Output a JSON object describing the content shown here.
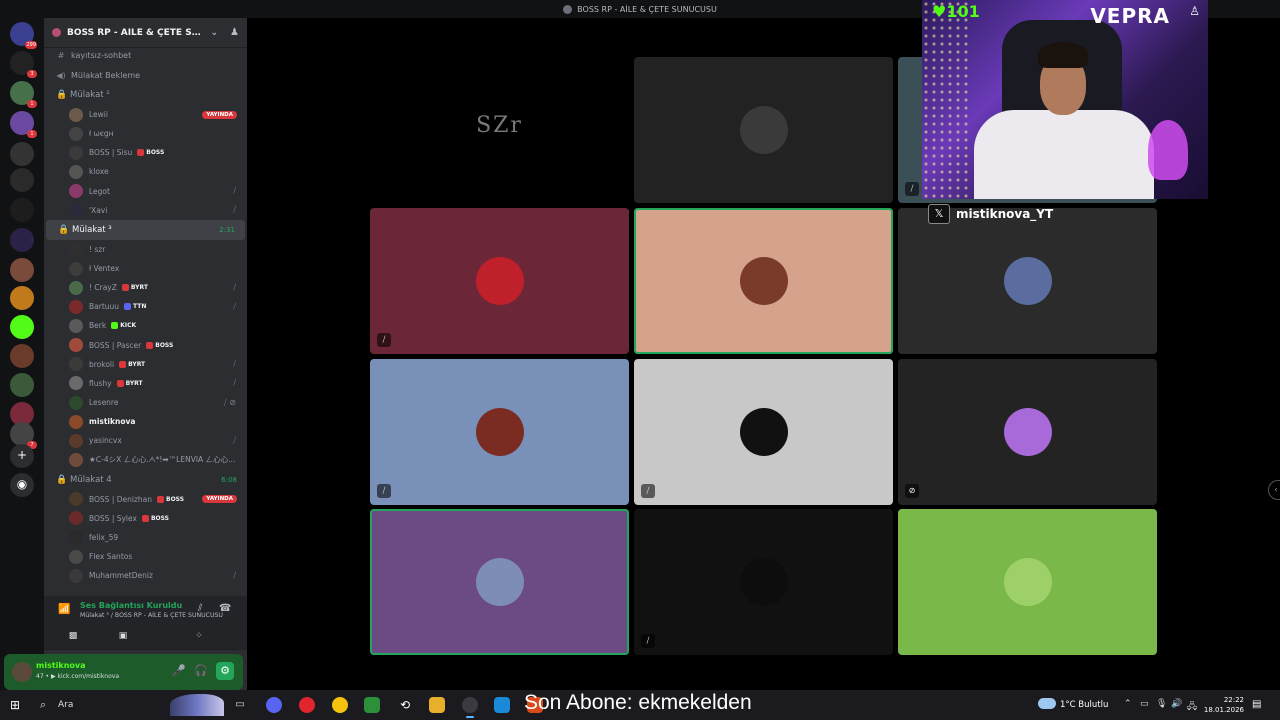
{
  "window": {
    "title": "BOSS RP - AİLE & ÇETE SUNUCUSU"
  },
  "server": {
    "name": "BOSS RP - AİLE & ÇETE SUNUCUSU"
  },
  "server_rail": {
    "badges": [
      "299",
      "3",
      "1",
      "1",
      "7"
    ]
  },
  "channels": [
    {
      "name": "kayıtsız-sohbet",
      "icon": "hash-icon"
    },
    {
      "name": "Mülakat Bekleme",
      "icon": "speaker-icon"
    }
  ],
  "voice_channels": [
    {
      "name": "Mülakat ²",
      "time": "",
      "users": [
        {
          "name": "Lewii",
          "live": "YAYINDA"
        },
        {
          "name": "ł ωєgн"
        },
        {
          "name": "BOSS | Sisu",
          "tag": "BOSS"
        },
        {
          "name": "kloxe"
        },
        {
          "name": "Legot",
          "mute": "⧸"
        },
        {
          "name": "'Xavi",
          "mute": "⧸"
        }
      ]
    },
    {
      "name": "Mülakat ³",
      "time": "2:31",
      "users": [
        {
          "name": "! szr"
        },
        {
          "name": "ł Ventex"
        },
        {
          "name": "! CrayZ",
          "tag": "BYRT",
          "mute": "⧸"
        },
        {
          "name": "Bartuuu",
          "tag": "TTN",
          "mute": "⧸"
        },
        {
          "name": "Berk",
          "tag": "KICK"
        },
        {
          "name": "BOSS | Pascer",
          "tag": "BOSS"
        },
        {
          "name": "brokoli",
          "tag": "BYRT",
          "mute": "⧸"
        },
        {
          "name": "flushy",
          "tag": "BYRT",
          "mute": "⧸"
        },
        {
          "name": "Lesenre",
          "mute": "⧸ ⊘"
        },
        {
          "name": "mistiknova",
          "bright": true
        },
        {
          "name": "yasincvx",
          "mute": "⧸"
        },
        {
          "name": "★ᑕ-4シX ㄥ心心.ᗅ*!➡™LENVIA ㄥ心心..."
        }
      ]
    },
    {
      "name": "Mülakat 4",
      "time": "6:08",
      "users": [
        {
          "name": "BOSS | Denizhan",
          "tag": "BOSS",
          "live": "YAYINDA"
        },
        {
          "name": "BOSS | Sylex",
          "tag": "BOSS"
        },
        {
          "name": "felix_59"
        },
        {
          "name": "Flex Santos"
        },
        {
          "name": "MuhammetDeniz",
          "mute": "⧸"
        }
      ]
    }
  ],
  "voice_status": {
    "title": "Ses Bağlantısı Kuruldu",
    "subtitle": "Mülakat ³ / BOSS RP - AİLE & ÇETE SUNUCUSU"
  },
  "user_panel": {
    "name": "mistiknova",
    "sub": "47 • ▶ kick.com/mistiknova"
  },
  "stage": {
    "tiles": [
      {
        "label": "szr",
        "bg": "#000000",
        "logo": "SZr",
        "muted": false
      },
      {
        "label": "tile-2",
        "bg": "#222222",
        "avatar": "#3a3a3a",
        "muted": false
      },
      {
        "label": "tile-3",
        "bg": "#3b4f57",
        "muted": true
      },
      {
        "label": "tile-4",
        "bg": "#6b2737",
        "avatar": "#c0202a",
        "muted": true
      },
      {
        "label": "tile-5",
        "bg": "#d5a28c",
        "avatar": "#7a3b2a",
        "muted": false,
        "selected": true
      },
      {
        "label": "tile-6",
        "bg": "#2b2b2b",
        "avatar": "#5a6d9e",
        "muted": false
      },
      {
        "label": "tile-7",
        "bg": "#7990b8",
        "avatar": "#7a2b22",
        "muted": true
      },
      {
        "label": "tile-8",
        "bg": "#c8c8c8",
        "avatar": "#111111",
        "muted": true
      },
      {
        "label": "tile-9",
        "bg": "#232323",
        "avatar": "#a86ad8",
        "muted": true,
        "mute_icon": "⊘"
      },
      {
        "label": "tile-10",
        "bg": "#6c4a83",
        "avatar": "#7e8db8",
        "muted": false,
        "selected": true
      },
      {
        "label": "tile-11",
        "bg": "#111111",
        "avatar": "#0d0d0d",
        "muted": true
      },
      {
        "label": "tile-12",
        "bg": "#7bb84a",
        "avatar": "#9ed06a",
        "muted": false
      }
    ]
  },
  "stream_overlay": {
    "heart_count": "♥101",
    "logo_text": "VEPRA",
    "x_handle": "mistiknova_YT"
  },
  "taskbar": {
    "search": "Ara",
    "banner": "Son Abone: ekmekelden",
    "weather": "1°C  Bulutlu",
    "time": "22:22",
    "date": "18.01.2026"
  }
}
